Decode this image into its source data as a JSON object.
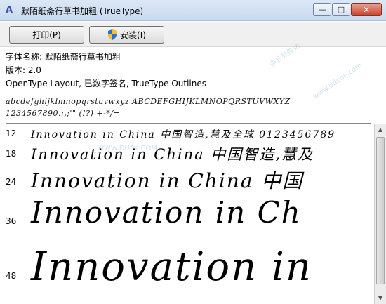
{
  "window": {
    "title": "默陌纸斋行草书加粗 (TrueType)",
    "icon": "font-file-icon",
    "buttons": {
      "minimize": "—",
      "maximize": "□",
      "close": "✕"
    }
  },
  "toolbar": {
    "print_label": "打印(P)",
    "install_label": "安装(I)"
  },
  "info": {
    "font_name": "字体名称: 默陌纸斋行草书加粗",
    "version": "版本: 2.0",
    "details": "OpenType Layout, 已数字签名, TrueType Outlines"
  },
  "charset": {
    "line1": "abcdefghijklmnopqrstuvwxyz ABCDEFGHIJKLMNOPQRSTUVWXYZ",
    "line2": "1234567890.:,;'\" (!?) +-*/="
  },
  "samples": [
    {
      "size": "12",
      "text": "Innovation in China 中国智造,慧及全球 0123456789"
    },
    {
      "size": "18",
      "text": "Innovation in China 中国智造,慧及"
    },
    {
      "size": "24",
      "text": "Innovation in China 中国"
    },
    {
      "size": "36",
      "text": "Innovation in Ch"
    },
    {
      "size": "48",
      "text": "Innovation in"
    }
  ],
  "watermarks": {
    "w1": "WWW.DUPK.COM",
    "w2": "多多软件站",
    "w3": "www.ddooo.com"
  }
}
